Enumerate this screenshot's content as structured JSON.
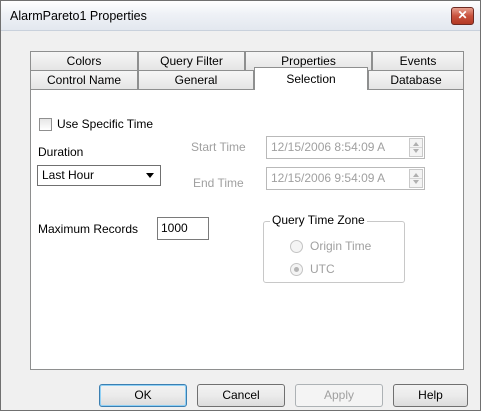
{
  "window": {
    "title": "AlarmPareto1 Properties",
    "close_glyph": "✕"
  },
  "tabs": {
    "back_row": [
      "Colors",
      "Query Filter",
      "Properties",
      "Events"
    ],
    "front_row": [
      "Control Name",
      "General",
      "Selection",
      "Database"
    ],
    "selected": "Selection"
  },
  "selection": {
    "use_specific_time": {
      "label": "Use Specific Time",
      "checked": false
    },
    "duration": {
      "label": "Duration",
      "value": "Last Hour"
    },
    "start_time": {
      "label": "Start Time",
      "value": "12/15/2006  8:54:09 A"
    },
    "end_time": {
      "label": "End Time",
      "value": "12/15/2006  9:54:09 A"
    },
    "maximum_records": {
      "label": "Maximum Records",
      "value": "1000"
    },
    "query_time_zone": {
      "label": "Query Time Zone",
      "options": [
        "Origin Time",
        "UTC"
      ],
      "selected": "UTC"
    }
  },
  "buttons": {
    "ok": "OK",
    "cancel": "Cancel",
    "apply": "Apply",
    "help": "Help"
  },
  "icons": {
    "close": "close-icon",
    "dropdown": "chevron-down-icon",
    "spinner": "spinner-arrows-icon"
  }
}
